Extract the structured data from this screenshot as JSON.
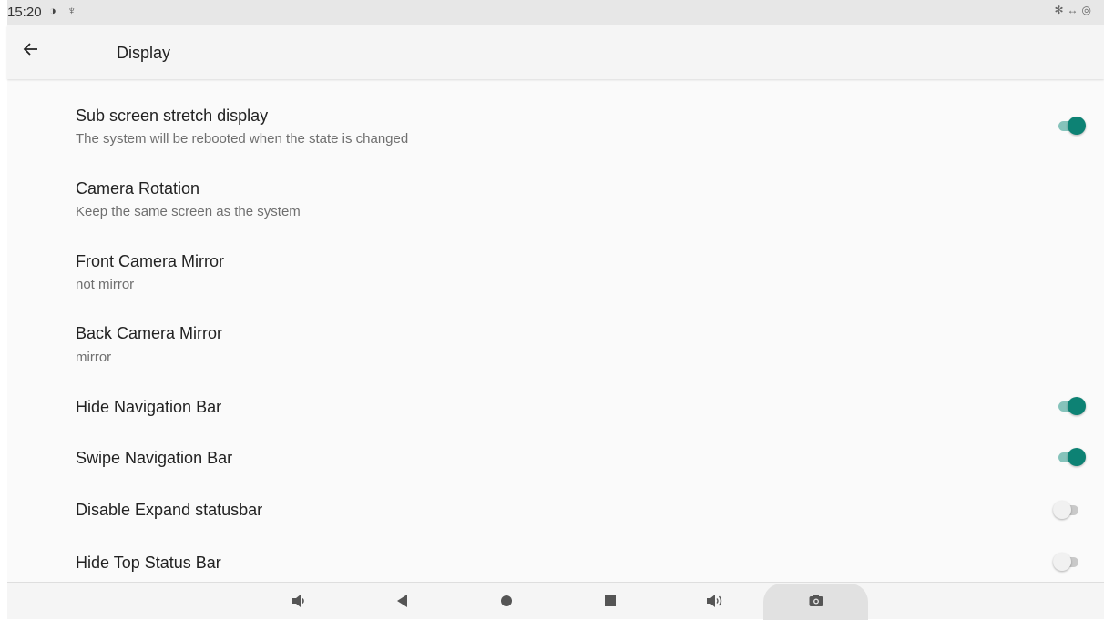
{
  "status_bar": {
    "time": "15:20",
    "left_icons": [
      "data-saver-icon",
      "usb-icon"
    ],
    "right_icons": [
      "bluetooth-icon",
      "ethernet-icon",
      "hotspot-icon"
    ]
  },
  "app_bar": {
    "title": "Display"
  },
  "settings": [
    {
      "title": "Sub screen stretch display",
      "summary": "The system will be rebooted when the state is changed",
      "switch": "on"
    },
    {
      "title": "Camera Rotation",
      "summary": "Keep the same screen as the system"
    },
    {
      "title": "Front Camera Mirror",
      "summary": "not mirror"
    },
    {
      "title": "Back Camera Mirror",
      "summary": "mirror"
    },
    {
      "title": "Hide Navigation Bar",
      "switch": "on"
    },
    {
      "title": "Swipe Navigation Bar",
      "switch": "on"
    },
    {
      "title": "Disable Expand statusbar",
      "switch": "off"
    },
    {
      "title": "Hide Top Status Bar",
      "switch": "off"
    }
  ],
  "nav_bar": {
    "buttons": [
      "volume-down-icon",
      "back-triangle-icon",
      "home-circle-icon",
      "recents-square-icon",
      "volume-up-icon",
      "screenshot-camera-icon"
    ]
  },
  "colors": {
    "switch_on": "#0d8274",
    "switch_on_track": "#86c3bb",
    "switch_off_thumb": "#f1f1f1",
    "switch_off_track": "#c9c9c9"
  }
}
